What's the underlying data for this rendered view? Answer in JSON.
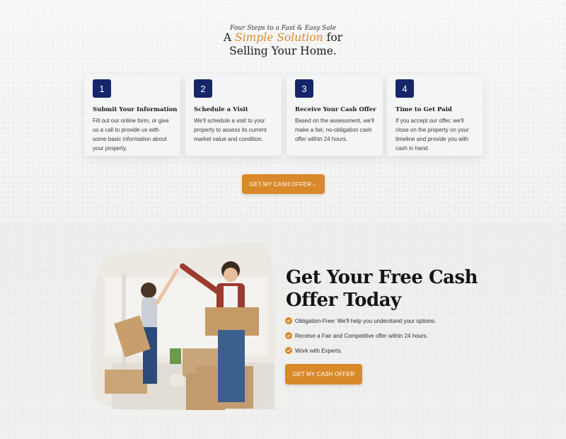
{
  "header": {
    "eyebrow": "Four Steps to a Fast & Easy Sale",
    "title_prefix": "A ",
    "title_accent": "Simple Solution",
    "title_suffix": " for",
    "title_line2": "Selling Your Home."
  },
  "steps": [
    {
      "number": "1",
      "title": "Submit Your Information",
      "body": "Fill out our online form, or give us a call to provide us with some basic information about your property."
    },
    {
      "number": "2",
      "title": "Schedule a Visit",
      "body": "We'll schedule a visit to your property to assess its current market value and condition."
    },
    {
      "number": "3",
      "title": "Receive Your Cash Offer",
      "body": "Based on the assessment, we'll make a fair, no-obligation cash offer within 24 hours."
    },
    {
      "number": "4",
      "title": "Time to Get Paid",
      "body": "If you accept our offer, we'll close on the property on your timeline and provide you with cash in hand."
    }
  ],
  "cta_top": {
    "label": "GET MY CASH OFFER→"
  },
  "offer": {
    "title_line1": "Get Your Free Cash",
    "title_line2": "Offer Today",
    "benefits": [
      "Obligation-Free: We'll help you understand your options.",
      "Receive a Fair and Competitive offer within 24 hours.",
      "Work with Experts."
    ],
    "cta_label": "GET MY CASH OFFER"
  },
  "colors": {
    "accent": "#d9892a",
    "navy": "#16266b"
  },
  "icons": {
    "benefit": "check-circle-icon"
  }
}
